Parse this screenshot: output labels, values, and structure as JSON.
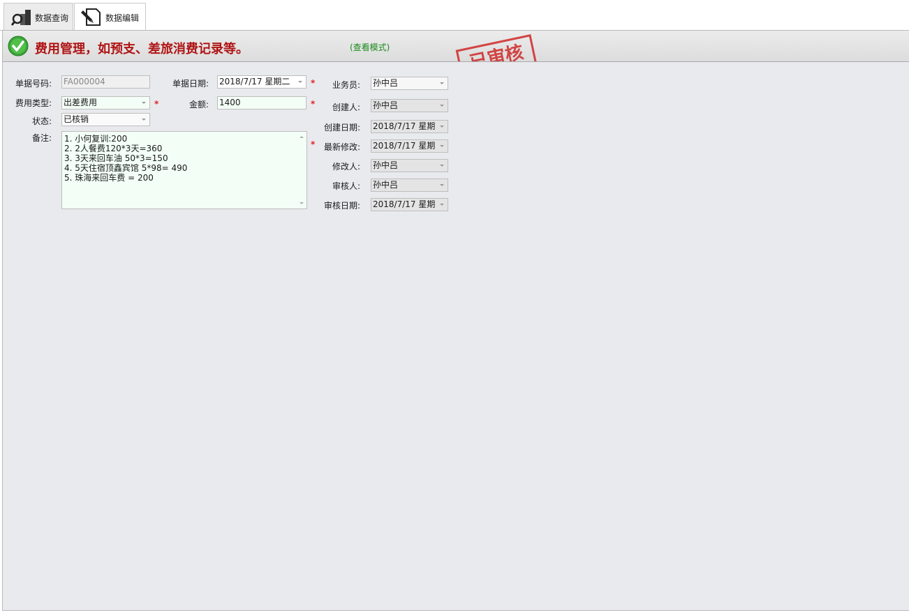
{
  "tabs": [
    {
      "label": "数据查询",
      "icon": "search-chart-icon"
    },
    {
      "label": "数据编辑",
      "icon": "edit-document-icon"
    }
  ],
  "header": {
    "title": "费用管理，如预支、差旅消费记录等。",
    "mode": "(查看模式)",
    "stamp": "已审核",
    "icon": "check-circle-icon"
  },
  "form": {
    "doc_no": {
      "label": "单据号码:",
      "value": "FA000004"
    },
    "doc_date": {
      "label": "单据日期:",
      "value": "2018/7/17 星期二"
    },
    "expense_type": {
      "label": "费用类型:",
      "value": "出差费用"
    },
    "amount": {
      "label": "金额:",
      "value": "1400"
    },
    "status": {
      "label": "状态:",
      "value": "已核销"
    },
    "remark": {
      "label": "备注:",
      "lines": [
        "1. 小何复训:200",
        "2. 2人餐费120*3天=360",
        "3. 3天来回车油 50*3=150",
        "4. 5天住宿顶鑫宾馆 5*98= 490",
        "5. 珠海来回车费 = 200"
      ]
    },
    "required_mark": "*"
  },
  "side": {
    "salesman": {
      "label": "业务员:",
      "value": "孙中吕"
    },
    "creator": {
      "label": "创建人:",
      "value": "孙中吕"
    },
    "create_date": {
      "label": "创建日期:",
      "value": "2018/7/17 星期"
    },
    "last_modified": {
      "label": "最新修改:",
      "value": "2018/7/17 星期"
    },
    "modifier": {
      "label": "修改人:",
      "value": "孙中吕"
    },
    "auditor": {
      "label": "审核人:",
      "value": "孙中吕"
    },
    "audit_date": {
      "label": "审核日期:",
      "value": "2018/7/17 星期"
    }
  },
  "colors": {
    "title": "#b01414",
    "mode": "#1a8a1a",
    "stamp": "#d02828",
    "required": "#e02020"
  }
}
